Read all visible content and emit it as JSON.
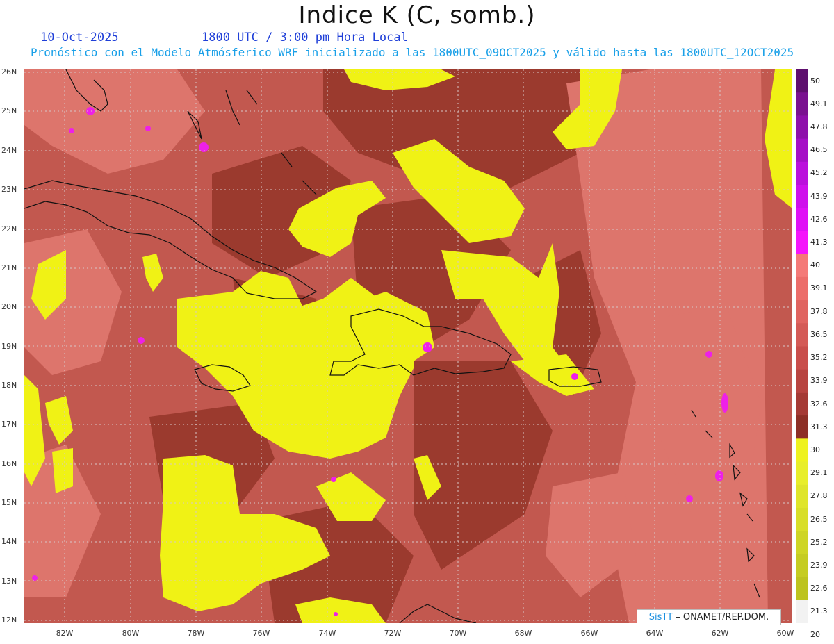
{
  "header": {
    "title": "Indice K (C, somb.)",
    "date": "10-Oct-2025",
    "time": "1800 UTC / 3:00 pm Hora Local",
    "description": "Pronóstico con el Modelo Atmósferico WRF inicializado a las 1800UTC_09OCT2025 y válido hasta las  1800UTC_12OCT2025"
  },
  "map": {
    "lat_labels": [
      "26N",
      "25N",
      "24N",
      "23N",
      "22N",
      "21N",
      "20N",
      "19N",
      "18N",
      "17N",
      "16N",
      "15N",
      "14N",
      "13N",
      "12N"
    ],
    "lon_labels": [
      "82W",
      "80W",
      "78W",
      "76W",
      "74W",
      "72W",
      "70W",
      "68W",
      "66W",
      "64W",
      "62W",
      "60W"
    ]
  },
  "colorbar": {
    "labels": [
      "50",
      "49.1",
      "47.8",
      "46.5",
      "45.2",
      "43.9",
      "42.6",
      "41.3",
      "40",
      "39.1",
      "37.8",
      "36.5",
      "35.2",
      "33.9",
      "32.6",
      "31.3",
      "30",
      "29.1",
      "27.8",
      "26.5",
      "25.2",
      "23.9",
      "22.6",
      "21.3",
      "20"
    ],
    "colors": [
      "#5e0f6e",
      "#7a1190",
      "#8e10ab",
      "#a50fc6",
      "#bb10dc",
      "#cf10ec",
      "#e010f6",
      "#f515fb",
      "#f47a78",
      "#ec6d6a",
      "#e06460",
      "#d45a56",
      "#c94e4b",
      "#b84440",
      "#a53a35",
      "#8d2f26",
      "#eef21f",
      "#e8ee2a",
      "#dfe52a",
      "#d8de28",
      "#ced525",
      "#c5cc22",
      "#bdc31f",
      "#f2f2f2"
    ]
  },
  "credit": {
    "brand": "SisTT",
    "text": "– ONAMET/REP.DOM."
  }
}
